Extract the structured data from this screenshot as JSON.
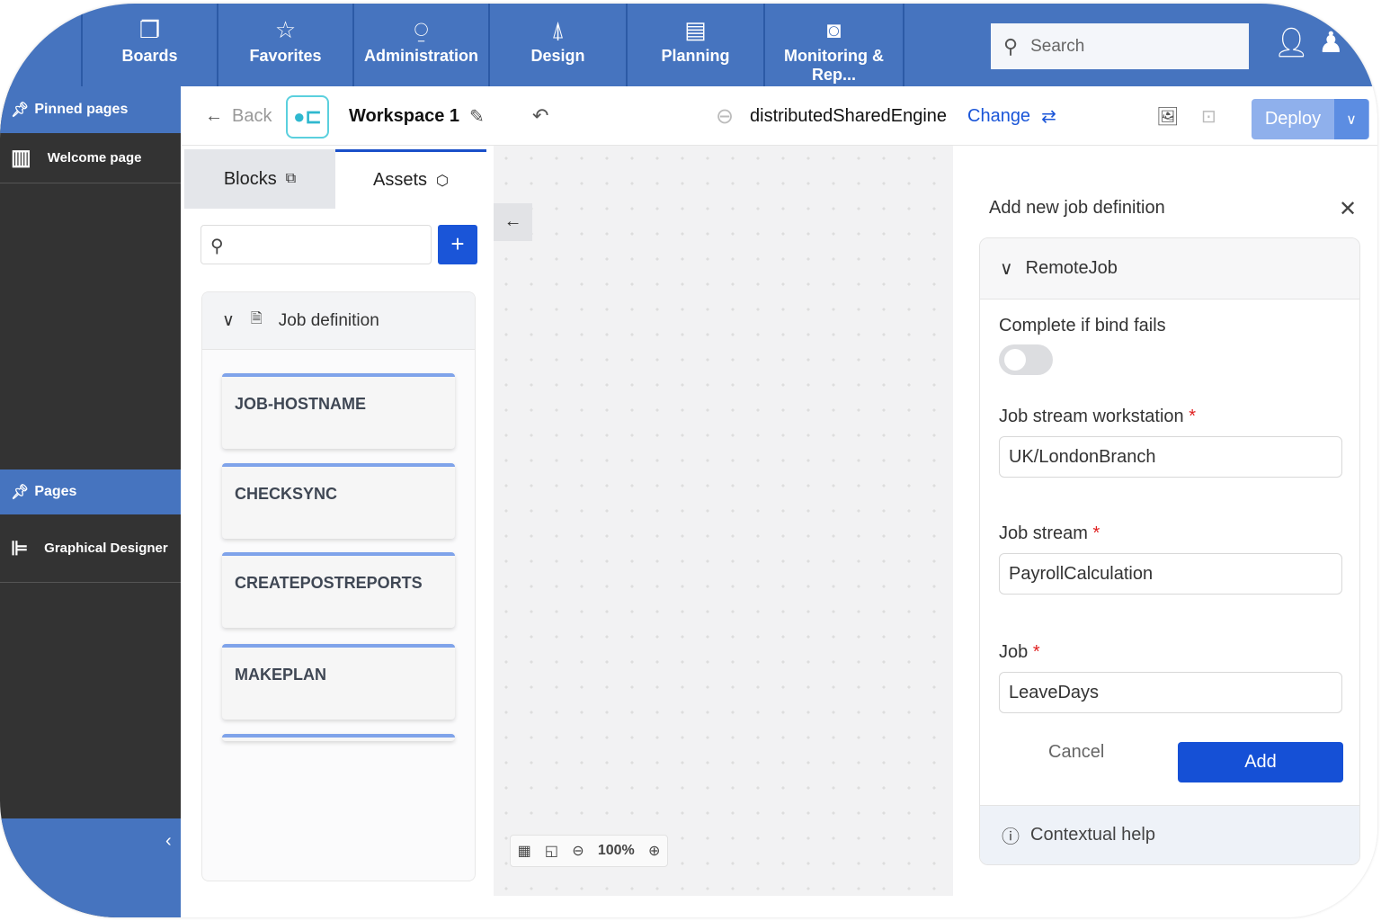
{
  "topnav": {
    "items": [
      {
        "label": "Boards",
        "icon": "boards-icon"
      },
      {
        "label": "Favorites",
        "icon": "star-icon"
      },
      {
        "label": "Administration",
        "icon": "admin-icon"
      },
      {
        "label": "Design",
        "icon": "compass-icon"
      },
      {
        "label": "Planning",
        "icon": "planning-icon"
      },
      {
        "label": "Monitoring & Rep...",
        "icon": "monitor-icon"
      }
    ],
    "search_placeholder": "Search"
  },
  "sidebar": {
    "pinned": "Pinned pages",
    "welcome": "Welcome page",
    "pages": "Pages",
    "designer": "Graphical Designer"
  },
  "toolbar": {
    "back": "Back",
    "workspace": "Workspace 1",
    "engine": "distributedSharedEngine",
    "change": "Change",
    "deploy": "Deploy"
  },
  "left": {
    "tabs": [
      "Blocks",
      "Assets"
    ],
    "group": "Job definition",
    "cards": [
      "JOB-HOSTNAME",
      "CHECKSYNC",
      "CREATEPOSTREPORTS",
      "MAKEPLAN"
    ]
  },
  "canvas": {
    "zoom": "100%"
  },
  "panel": {
    "title": "Add new job definition",
    "section": "RemoteJob",
    "complete_label": "Complete if bind fails",
    "complete_value": false,
    "ws_label": "Job stream workstation",
    "ws_value": "UK/LondonBranch",
    "js_label": "Job stream",
    "js_value": "PayrollCalculation",
    "job_label": "Job",
    "job_value": "LeaveDays",
    "required": "*",
    "cancel": "Cancel",
    "add": "Add",
    "help": "Contextual help"
  }
}
